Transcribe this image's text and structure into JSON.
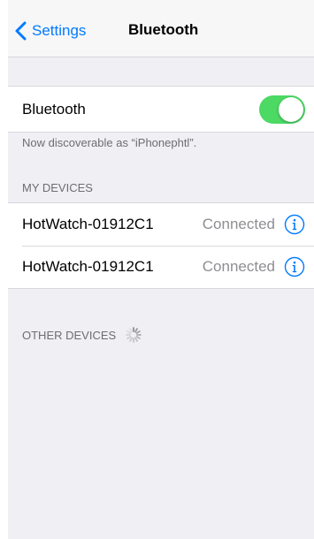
{
  "nav": {
    "back_label": "Settings",
    "title": "Bluetooth"
  },
  "bluetooth": {
    "label": "Bluetooth",
    "enabled": true,
    "discoverable_text": "Now discoverable as “iPhonephtl”."
  },
  "my_devices": {
    "header": "MY DEVICES",
    "items": [
      {
        "name": "HotWatch-01912C1",
        "status": "Connected"
      },
      {
        "name": "HotWatch-01912C1",
        "status": "Connected"
      }
    ]
  },
  "other_devices": {
    "header": "OTHER DEVICES"
  },
  "colors": {
    "accent": "#007aff",
    "toggle_on": "#4cd964",
    "background": "#efeff4",
    "secondary_text": "#8e8e93"
  }
}
